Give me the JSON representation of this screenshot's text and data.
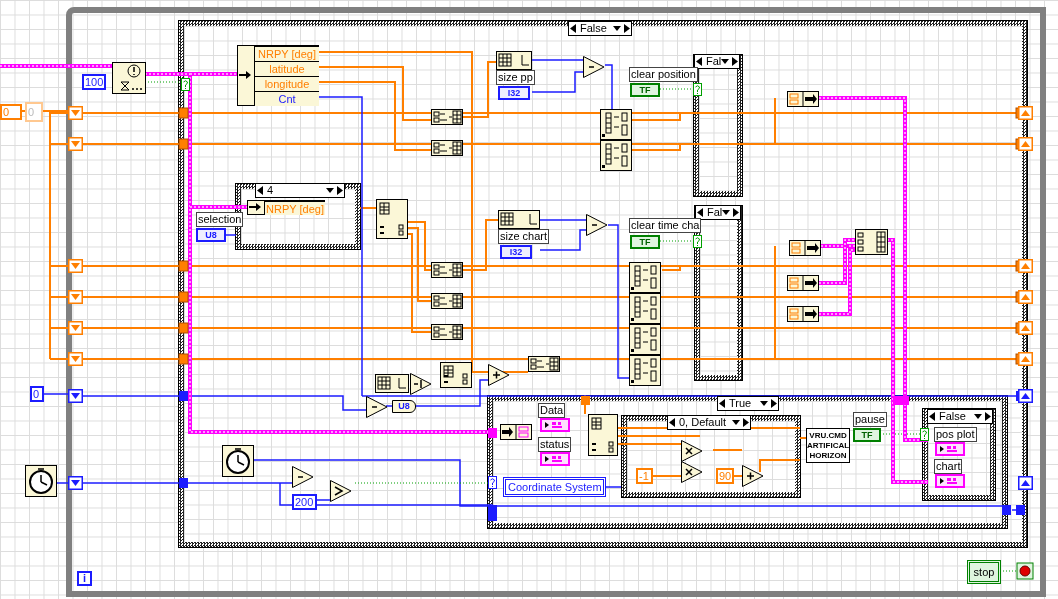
{
  "while_loop": {
    "iteration_terminal": "i",
    "stop_button": {
      "label": "stop"
    }
  },
  "case_structures": [
    {
      "selector": "False"
    },
    {
      "selector": "4"
    },
    {
      "selector": "Fal"
    },
    {
      "selector": "Fal"
    },
    {
      "selector": "True"
    },
    {
      "selector": "0, Default"
    },
    {
      "selector": "False"
    }
  ],
  "unbundle_nodes": [
    {
      "fields": [
        {
          "name": "NRPY [deg]",
          "kind": "double"
        },
        {
          "name": "latitude",
          "kind": "double"
        },
        {
          "name": "longitude",
          "kind": "double"
        },
        {
          "name": "Cnt",
          "kind": "integer"
        }
      ]
    },
    {
      "fields": [
        {
          "name": "NRPY [deg]",
          "kind": "double"
        }
      ]
    }
  ],
  "labels": [
    "size pp",
    "size chart",
    "clear position",
    "clear time cha",
    "selection",
    "Data",
    "status",
    "pause",
    "pos plot",
    "chart"
  ],
  "terminals": [
    {
      "text": "I32",
      "kind": "integer"
    },
    {
      "text": "I32",
      "kind": "integer"
    },
    {
      "text": "TF",
      "kind": "boolean"
    },
    {
      "text": "TF",
      "kind": "boolean"
    },
    {
      "text": "U8",
      "kind": "integer"
    },
    {
      "text": "TF",
      "kind": "boolean"
    }
  ],
  "constants": [
    {
      "text": "100",
      "kind": "integer",
      "disabled": false
    },
    {
      "text": "0",
      "kind": "double",
      "disabled": false
    },
    {
      "text": "0",
      "kind": "double",
      "disabled": true
    },
    {
      "text": "0",
      "kind": "integer",
      "disabled": false
    },
    {
      "text": "200",
      "kind": "integer",
      "disabled": false
    },
    {
      "text": "-1",
      "kind": "double",
      "disabled": false
    },
    {
      "text": "90",
      "kind": "double",
      "disabled": false
    }
  ],
  "enum_constant": {
    "text": "Coordinate System"
  },
  "conversion_node": {
    "text": "U8"
  },
  "subvi": {
    "lines": [
      "VRU.CMD",
      "ARTIFICAL",
      "HORIZON"
    ]
  }
}
